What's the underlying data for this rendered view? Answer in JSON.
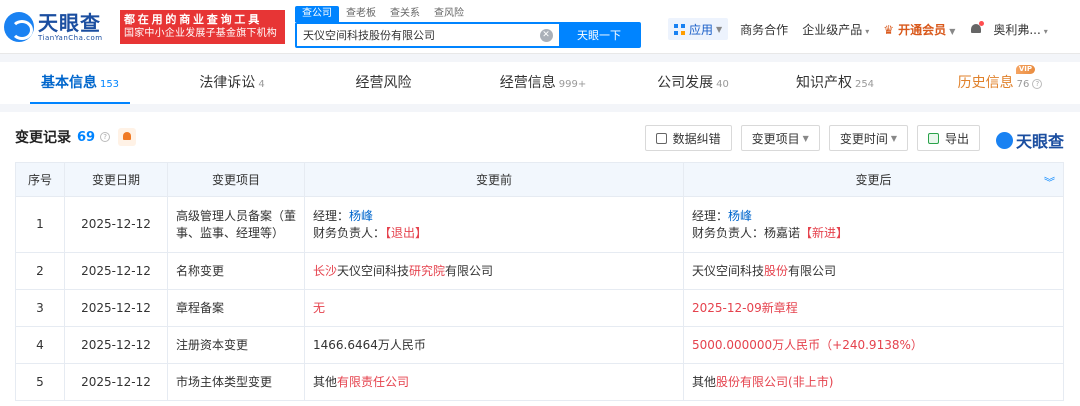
{
  "header": {
    "logo_cn": "天眼查",
    "logo_en": "TianYanCha.com",
    "slogan_line1": "都在用的商业查询工具",
    "slogan_line2": "国家中小企业发展子基金旗下机构",
    "search_tabs": [
      "查公司",
      "查老板",
      "查关系",
      "查风险"
    ],
    "search_value": "天仪空间科技股份有限公司",
    "search_button": "天眼一下",
    "nav": {
      "app": "应用",
      "business": "商务合作",
      "enterprise": "企业级产品",
      "vip": "开通会员",
      "user": "奥利弗..."
    }
  },
  "tabs": [
    {
      "label": "基本信息",
      "count": "153"
    },
    {
      "label": "法律诉讼",
      "count": "4"
    },
    {
      "label": "经营风险",
      "count": ""
    },
    {
      "label": "经营信息",
      "count": "999+"
    },
    {
      "label": "公司发展",
      "count": "40"
    },
    {
      "label": "知识产权",
      "count": "254"
    },
    {
      "label": "历史信息",
      "count": "76",
      "badge": "VIP"
    }
  ],
  "panel": {
    "title": "变更记录",
    "count": "69",
    "buttons": {
      "correct": "数据纠错",
      "item": "变更项目",
      "time": "变更时间",
      "export": "导出"
    },
    "brand": "天眼查",
    "columns": [
      "序号",
      "变更日期",
      "变更项目",
      "变更前",
      "变更后"
    ],
    "rows": [
      {
        "no": "1",
        "date": "2025-12-12",
        "item": "高级管理人员备案（董事、监事、经理等）",
        "before_l1_label": "经理：",
        "before_l1_name": "杨峰",
        "before_l2_label": "财务负责人：",
        "before_l2_tag": "【退出】",
        "after_l1_label": "经理：",
        "after_l1_name": "杨峰",
        "after_l2_label": "财务负责人：杨嘉诺",
        "after_l2_tag": "【新进】"
      },
      {
        "no": "2",
        "date": "2025-12-12",
        "item": "名称变更",
        "before_a": "长沙",
        "before_b": "天仪空间科技",
        "before_c": "研究院",
        "before_d": "有限公司",
        "after_a": "天仪空间科技",
        "after_b": "股份",
        "after_c": "有限公司"
      },
      {
        "no": "3",
        "date": "2025-12-12",
        "item": "章程备案",
        "before": "无",
        "after": "2025-12-09新章程"
      },
      {
        "no": "4",
        "date": "2025-12-12",
        "item": "注册资本变更",
        "before": "1466.6464万人民币",
        "after": "5000.000000万人民币（+240.9138%）"
      },
      {
        "no": "5",
        "date": "2025-12-12",
        "item": "市场主体类型变更",
        "before_a": "其他",
        "before_b": "有限责任公司",
        "after_a": "其他",
        "after_b": "股份有限公司(非上市)"
      }
    ]
  }
}
